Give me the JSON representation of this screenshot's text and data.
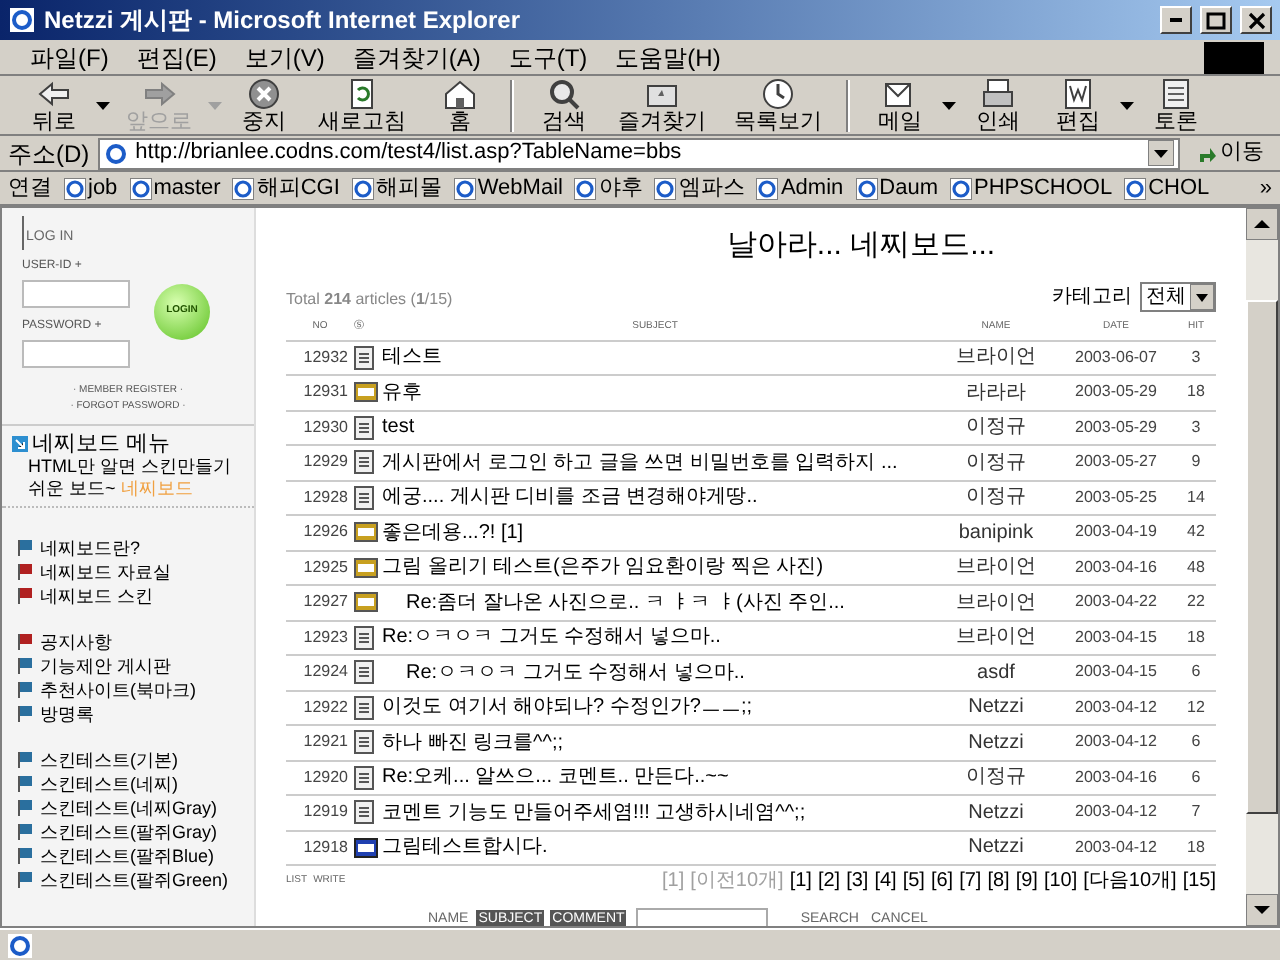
{
  "window": {
    "title": "Netzzi 게시판 - Microsoft Internet Explorer"
  },
  "menu": [
    "파일(F)",
    "편집(E)",
    "보기(V)",
    "즐겨찾기(A)",
    "도구(T)",
    "도움말(H)"
  ],
  "toolbar": [
    {
      "label": "뒤로",
      "kind": "back",
      "disabled": false,
      "dropdown": true
    },
    {
      "label": "앞으로",
      "kind": "forward",
      "disabled": true,
      "dropdown": true
    },
    {
      "label": "중지",
      "kind": "stop",
      "disabled": false,
      "dropdown": false
    },
    {
      "label": "새로고침",
      "kind": "refresh",
      "disabled": false,
      "dropdown": false
    },
    {
      "label": "홈",
      "kind": "home",
      "disabled": false,
      "dropdown": false
    },
    {
      "label": "검색",
      "kind": "search",
      "disabled": false,
      "dropdown": false
    },
    {
      "label": "즐겨찾기",
      "kind": "favorites",
      "disabled": false,
      "dropdown": false
    },
    {
      "label": "목록보기",
      "kind": "history",
      "disabled": false,
      "dropdown": false
    },
    {
      "label": "메일",
      "kind": "mail",
      "disabled": false,
      "dropdown": true
    },
    {
      "label": "인쇄",
      "kind": "print",
      "disabled": false,
      "dropdown": false
    },
    {
      "label": "편집",
      "kind": "edit",
      "disabled": false,
      "dropdown": true
    },
    {
      "label": "토론",
      "kind": "discuss",
      "disabled": false,
      "dropdown": false
    }
  ],
  "address": {
    "label": "주소(D)",
    "url": "http://brianlee.codns.com/test4/list.asp?TableName=bbs",
    "go": "이동"
  },
  "links": {
    "label": "연결",
    "items": [
      "job",
      "master",
      "해피CGI",
      "해피몰",
      "WebMail",
      "야후",
      "엠파스",
      "Admin",
      "Daum",
      "PHPSCHOOL",
      "CHOL"
    ],
    "more": "»"
  },
  "login": {
    "title": "LOG IN",
    "user_label": "USER-ID +",
    "password_label": "PASSWORD +",
    "button": "LOGIN",
    "register": "· MEMBER REGISTER ·",
    "forgot": "· FORGOT PASSWORD ·"
  },
  "board_menu": {
    "title": "네찌보드 메뉴",
    "line1": "HTML만 알면 스킨만들기",
    "line2": "쉬운 보드~",
    "brand": "네찌보드"
  },
  "nav_groups": [
    [
      {
        "label": "네찌보드란?",
        "color": "#2a6f9e"
      },
      {
        "label": "네찌보드 자료실",
        "color": "#b02020"
      },
      {
        "label": "네찌보드 스킨",
        "color": "#b02020"
      }
    ],
    [
      {
        "label": "공지사항",
        "color": "#b02020"
      },
      {
        "label": "기능제안 게시판",
        "color": "#2a6f9e"
      },
      {
        "label": "추천사이트(북마크)",
        "color": "#2a6f9e"
      },
      {
        "label": "방명록",
        "color": "#2a6f9e"
      }
    ],
    [
      {
        "label": "스킨테스트(기본)",
        "color": "#2a6f9e"
      },
      {
        "label": "스킨테스트(네찌)",
        "color": "#2a6f9e"
      },
      {
        "label": "스킨테스트(네찌Gray)",
        "color": "#2a6f9e"
      },
      {
        "label": "스킨테스트(팔쥐Gray)",
        "color": "#2a6f9e"
      },
      {
        "label": "스킨테스트(팔쥐Blue)",
        "color": "#2a6f9e"
      },
      {
        "label": "스킨테스트(팔쥐Green)",
        "color": "#2a6f9e"
      }
    ]
  ],
  "board": {
    "title": "날아라... 네찌보드...",
    "total": "Total **214** articles (**1**/15)",
    "category_label": "카테고리",
    "category": "전체",
    "columns": [
      "NO",
      "Ⓢ",
      "SUBJECT",
      "NAME",
      "DATE",
      "HIT"
    ],
    "rows": [
      {
        "no": "12932",
        "kind": "doc",
        "subject": "테스트",
        "name": "브라이언",
        "date": "2003-06-07",
        "hit": "3"
      },
      {
        "no": "12931",
        "kind": "jpg",
        "subject": "유후",
        "name": "라라라",
        "date": "2003-05-29",
        "hit": "18"
      },
      {
        "no": "12930",
        "kind": "doc",
        "subject": "test",
        "name": "이정규",
        "date": "2003-05-29",
        "hit": "3"
      },
      {
        "no": "12929",
        "kind": "doc",
        "subject": "게시판에서 로그인 하고 글을 쓰면 비밀번호를 입력하지 ...",
        "name": "이정규",
        "date": "2003-05-27",
        "hit": "9"
      },
      {
        "no": "12928",
        "kind": "doc",
        "subject": "에궁.... 게시판 디비를 조금 변경해야게땅..",
        "name": "이정규",
        "date": "2003-05-25",
        "hit": "14"
      },
      {
        "no": "12926",
        "kind": "jpg",
        "subject": "좋은데용...?! [1]",
        "name": "banipink",
        "date": "2003-04-19",
        "hit": "42"
      },
      {
        "no": "12925",
        "kind": "jpg",
        "subject": "그림 올리기 테스트(은주가 임요환이랑 찍은 사진)",
        "name": "브라이언",
        "date": "2003-04-16",
        "hit": "48",
        "children": [
          {
            "no": "12927",
            "kind": "jpg",
            "subject": "Re:좀더 잘나온 사진으로.. ㅋ ㅑㅋ ㅑ(사진 주인...",
            "name": "브라이언",
            "date": "2003-04-22",
            "hit": "22"
          }
        ]
      },
      {
        "no": "12923",
        "kind": "doc",
        "subject": "Re:ㅇㅋㅇㅋ 그거도 수정해서 넣으마..",
        "name": "브라이언",
        "date": "2003-04-15",
        "hit": "18",
        "children": [
          {
            "no": "12924",
            "kind": "doc",
            "subject": "Re:ㅇㅋㅇㅋ 그거도 수정해서 넣으마..",
            "name": "asdf",
            "date": "2003-04-15",
            "hit": "6"
          }
        ]
      },
      {
        "no": "12922",
        "kind": "doc",
        "subject": "이것도 여기서 해야되나? 수정인가?ㅡㅡ;;",
        "name": "Netzzi",
        "date": "2003-04-12",
        "hit": "12"
      },
      {
        "no": "12921",
        "kind": "doc",
        "subject": "하나 빠진 링크를^^;;",
        "name": "Netzzi",
        "date": "2003-04-12",
        "hit": "6"
      },
      {
        "no": "12920",
        "kind": "doc",
        "subject": "Re:오케... 알쓰으... 코멘트.. 만든다..~~",
        "name": "이정규",
        "date": "2003-04-16",
        "hit": "6"
      },
      {
        "no": "12919",
        "kind": "doc",
        "subject": "코멘트 기능도 만들어주세염!!! 고생하시네염^^;;",
        "name": "Netzzi",
        "date": "2003-04-12",
        "hit": "7"
      },
      {
        "no": "12918",
        "kind": "bmp",
        "subject": "그림테스트합시다.",
        "name": "Netzzi",
        "date": "2003-04-12",
        "hit": "18"
      }
    ],
    "actions": [
      "LIST",
      "WRITE"
    ],
    "pages": [
      {
        "label": "[1]",
        "disabled": true
      },
      {
        "label": "[이전10개]",
        "disabled": true
      },
      {
        "label": "[1]",
        "disabled": false
      },
      {
        "label": "[2]",
        "disabled": false
      },
      {
        "label": "[3]",
        "disabled": false
      },
      {
        "label": "[4]",
        "disabled": false
      },
      {
        "label": "[5]",
        "disabled": false
      },
      {
        "label": "[6]",
        "disabled": false
      },
      {
        "label": "[7]",
        "disabled": false
      },
      {
        "label": "[8]",
        "disabled": false
      },
      {
        "label": "[9]",
        "disabled": false
      },
      {
        "label": "[10]",
        "disabled": false
      },
      {
        "label": "[다음10개]",
        "disabled": false
      },
      {
        "label": "[15]",
        "disabled": false
      }
    ],
    "search_fields": [
      {
        "label": "NAME",
        "selected": false
      },
      {
        "label": "SUBJECT",
        "selected": true
      },
      {
        "label": "COMMENT",
        "selected": true
      }
    ],
    "search_buttons": [
      "SEARCH",
      "CANCEL"
    ]
  }
}
